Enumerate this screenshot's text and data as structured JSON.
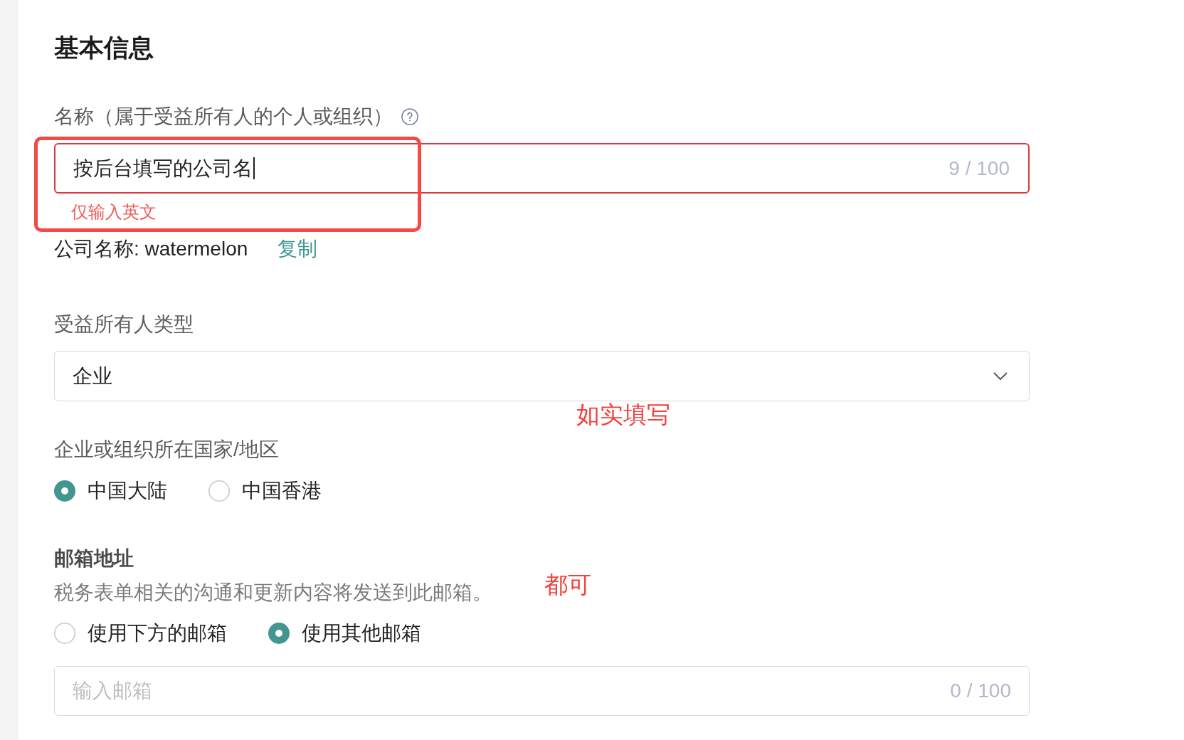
{
  "section_title": "基本信息",
  "name_field": {
    "label": "名称（属于受益所有人的个人或组织）",
    "value": "按后台填写的公司名",
    "focused": true,
    "counter": "9 / 100",
    "invalid": true,
    "error": "仅输入英文",
    "annotated": true
  },
  "company_hint": {
    "text": "公司名称: watermelon",
    "action": "复制"
  },
  "owner_type": {
    "label": "受益所有人类型",
    "value": "企业",
    "annotation": "如实填写"
  },
  "region": {
    "label": "企业或组织所在国家/地区",
    "options": [
      {
        "label": "中国大陆",
        "selected": true
      },
      {
        "label": "中国香港",
        "selected": false
      }
    ]
  },
  "email": {
    "label": "邮箱地址",
    "description": "税务表单相关的沟通和更新内容将发送到此邮箱。",
    "annotation": "都可",
    "options": [
      {
        "label": "使用下方的邮箱",
        "selected": false
      },
      {
        "label": "使用其他邮箱",
        "selected": true
      }
    ],
    "input": {
      "placeholder": "输入邮箱",
      "counter": "0 / 100"
    }
  }
}
